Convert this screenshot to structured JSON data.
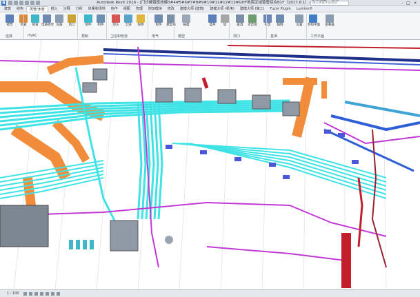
{
  "window": {
    "title": "Autodesk Revit 2016 -    [门诊楼暨医技楼3#4#5#6#7#8#9#10#11#12#13#GHF地库区域暨管综合B1F（2017.8.1）- 三维视图: {三维}",
    "search_placeholder": "键入关键字或短语",
    "minimize": "–",
    "maximize": "□",
    "close": "×"
  },
  "tabs": [
    {
      "label": "建筑"
    },
    {
      "label": "结构"
    },
    {
      "label": "风管/水管"
    },
    {
      "label": "插入"
    },
    {
      "label": "注释"
    },
    {
      "label": "分析"
    },
    {
      "label": "体量和场地"
    },
    {
      "label": "协作"
    },
    {
      "label": "视图"
    },
    {
      "label": "管理"
    },
    {
      "label": "附加模块"
    },
    {
      "label": "修改"
    },
    {
      "label": "建模大师 (建筑)"
    },
    {
      "label": "建模大师 (机电)"
    },
    {
      "label": "建模大师 (施工)"
    },
    {
      "label": "Fuzor Plugin"
    },
    {
      "label": "Lumion®"
    }
  ],
  "ribbon": {
    "buttons": [
      {
        "label": "修改"
      },
      {
        "label": "风管"
      },
      {
        "label": "管道"
      },
      {
        "label": "电缆桥架"
      },
      {
        "label": "设备"
      },
      {
        "label": "风口"
      },
      {
        "label": "管件"
      },
      {
        "label": "附件"
      },
      {
        "label": "喷头"
      },
      {
        "label": "卫浴"
      },
      {
        "label": "照明"
      },
      {
        "label": "构件"
      },
      {
        "label": "模型线"
      },
      {
        "label": "按面"
      },
      {
        "label": "竖井"
      },
      {
        "label": "墙"
      },
      {
        "label": "垂直"
      },
      {
        "label": "老虎窗"
      },
      {
        "label": "标高"
      },
      {
        "label": "轴网"
      },
      {
        "label": "设置"
      },
      {
        "label": "参照平面"
      },
      {
        "label": "查看器"
      }
    ],
    "panels": [
      {
        "label": "选择"
      },
      {
        "label": "HVAC"
      },
      {
        "label": "预制"
      },
      {
        "label": "卫浴和管道"
      },
      {
        "label": "电气"
      },
      {
        "label": "模型"
      },
      {
        "label": "洞口"
      },
      {
        "label": "基准"
      },
      {
        "label": "工作平面"
      }
    ]
  },
  "statusbar": {
    "scale": "1 : 100"
  },
  "colors": {
    "duct": "#f08c3a",
    "pipe_cyan": "#3fe3e6",
    "pipe_magenta": "#c238d6",
    "pipe_red": "#c21e2c",
    "pipe_blue": "#2f5fd6",
    "equipment": "#8f9aa6",
    "ribbon_bg": "#f5f6f8"
  }
}
